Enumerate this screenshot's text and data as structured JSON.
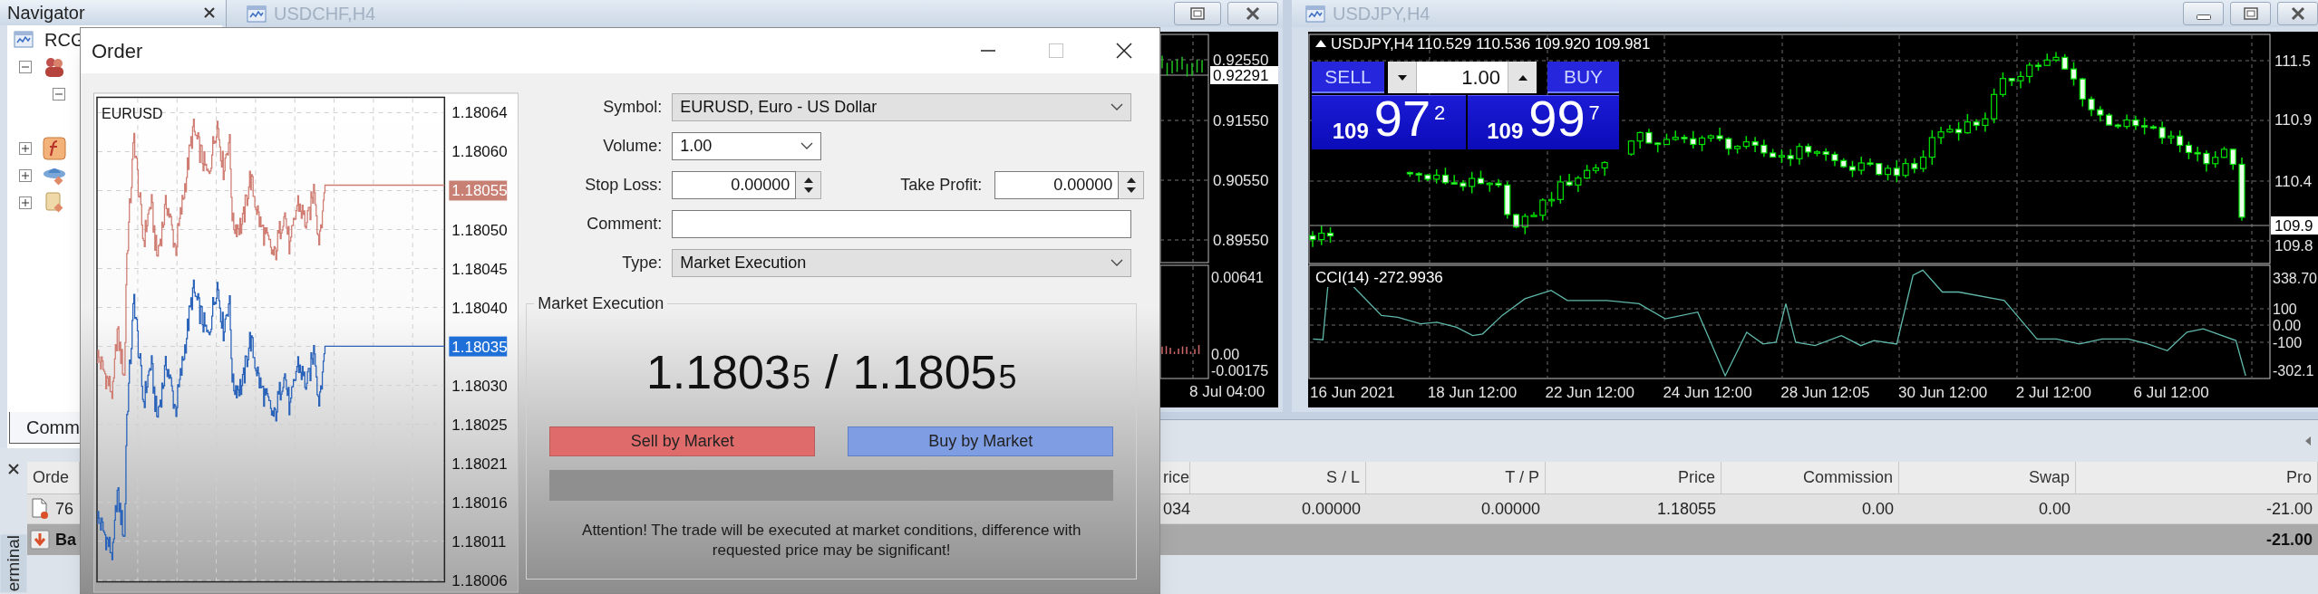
{
  "navigator": {
    "title": "Navigator",
    "tree": {
      "label": "RCG",
      "children": [
        {
          "kind": "accounts",
          "expanded": true,
          "children": [
            {
              "expanded": true
            }
          ]
        },
        {
          "kind": "indicators",
          "expanded": false
        },
        {
          "kind": "experts",
          "expanded": false
        },
        {
          "kind": "scripts",
          "expanded": false
        }
      ]
    },
    "tab": "Comm"
  },
  "left_chart_window": {
    "title": "USDCHF,H4",
    "price_scale": [
      {
        "label": "0.92550"
      },
      {
        "label": "0.92291",
        "kind": "current"
      },
      {
        "label": "0.91550"
      },
      {
        "label": "0.90550"
      },
      {
        "label": "0.89550"
      }
    ],
    "indicator_scale": [
      "0.00641",
      "0.00",
      "-0.00175"
    ],
    "time_axis": [
      "8 Jul 04:00"
    ]
  },
  "right_chart_window": {
    "title": "USDJPY,H4",
    "header": {
      "symbol": "USDJPY,H4",
      "ohlc": "110.529 110.536 109.920 109.981"
    },
    "one_click": {
      "sell": "SELL",
      "buy": "BUY",
      "volume": "1.00",
      "bid": {
        "big": "109",
        "main": "97",
        "sup": "2"
      },
      "ask": {
        "big": "109",
        "main": "99",
        "sup": "7"
      }
    },
    "price_scale": [
      {
        "label": "111.5"
      },
      {
        "label": "110.9"
      },
      {
        "label": "110.4"
      },
      {
        "label": "109.9",
        "kind": "current"
      },
      {
        "label": "109.8"
      }
    ],
    "indicator": {
      "label": "CCI(14) -272.9936",
      "scale": [
        "338.70",
        "100",
        "0.00",
        "-100",
        "-302.1"
      ]
    },
    "time_axis": [
      "16 Jun 2021",
      "18 Jun 12:00",
      "22 Jun 12:00",
      "24 Jun 12:00",
      "28 Jun 12:05",
      "30 Jun 12:00",
      "2 Jul 12:00",
      "6 Jul 12:00"
    ]
  },
  "order_dialog": {
    "title": "Order",
    "chart": {
      "symbol": "EURUSD",
      "price_scale": [
        {
          "label": "1.18064"
        },
        {
          "label": "1.18060"
        },
        {
          "label": "1.18055",
          "kind": "ask"
        },
        {
          "label": "1.18050"
        },
        {
          "label": "1.18045"
        },
        {
          "label": "1.18040"
        },
        {
          "label": "1.18035",
          "kind": "bid"
        },
        {
          "label": "1.18030"
        },
        {
          "label": "1.18025"
        },
        {
          "label": "1.18021"
        },
        {
          "label": "1.18016"
        },
        {
          "label": "1.18011"
        },
        {
          "label": "1.18006"
        }
      ]
    },
    "form": [
      [
        {
          "label": "Symbol:",
          "kind": "select",
          "value": "EURUSD, Euro - US Dollar"
        }
      ],
      [
        {
          "label": "Volume:",
          "kind": "combo",
          "value": "1.00"
        }
      ],
      [
        {
          "label": "Stop Loss:",
          "kind": "spin",
          "value": "0.00000"
        },
        {
          "label": "Take Profit:",
          "kind": "spin",
          "value": "0.00000"
        }
      ],
      [
        {
          "label": "Comment:",
          "kind": "text"
        }
      ],
      [
        {
          "label": "Type:",
          "kind": "select",
          "value": "Market Execution"
        }
      ]
    ],
    "execution": {
      "title": "Market Execution",
      "bid": {
        "main": "1.1803",
        "small": "5"
      },
      "separator": "/",
      "ask": {
        "main": "1.1805",
        "small": "5"
      },
      "sell_button": "Sell by Market",
      "buy_button": "Buy by Market",
      "notice": "Attention! The trade will be executed at market conditions, difference with requested price may be significant!"
    }
  },
  "terminal": {
    "title": "erminal",
    "columns": [
      "Orde",
      "rice",
      "S / L",
      "T / P",
      "Price",
      "Commission",
      "Swap",
      "Pro"
    ],
    "rows": [
      {
        "kind": "order",
        "cells": [
          "76",
          "034",
          "0.00000",
          "0.00000",
          "1.18055",
          "0.00",
          "0.00",
          "-21.00"
        ]
      },
      {
        "kind": "balance",
        "label": "Ba",
        "total": "-21.00"
      }
    ]
  }
}
